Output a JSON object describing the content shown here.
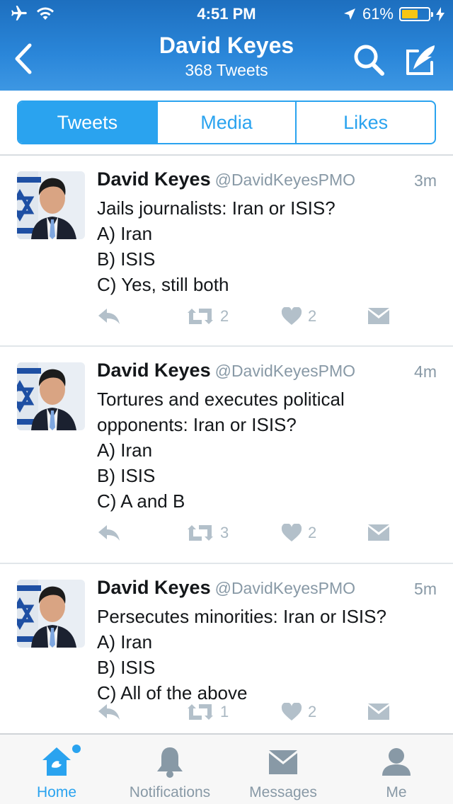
{
  "status": {
    "time": "4:51 PM",
    "battery": "61%"
  },
  "header": {
    "title": "David Keyes",
    "subtitle": "368 Tweets"
  },
  "segments": [
    {
      "label": "Tweets",
      "active": true
    },
    {
      "label": "Media",
      "active": false
    },
    {
      "label": "Likes",
      "active": false
    }
  ],
  "tweets": [
    {
      "name": "David Keyes",
      "handle": "@DavidKeyesPMO",
      "time": "3m",
      "lines": [
        "Jails journalists: Iran or ISIS?",
        "A) Iran",
        "B) ISIS",
        "C) Yes, still both"
      ],
      "retweets": "2",
      "likes": "2"
    },
    {
      "name": "David Keyes",
      "handle": "@DavidKeyesPMO",
      "time": "4m",
      "lines": [
        "Tortures and executes political",
        "opponents: Iran or ISIS?",
        "A) Iran",
        "B) ISIS",
        "C) A and B"
      ],
      "retweets": "3",
      "likes": "2"
    },
    {
      "name": "David Keyes",
      "handle": "@DavidKeyesPMO",
      "time": "5m",
      "lines": [
        "Persecutes minorities: Iran or ISIS?",
        "A) Iran",
        "B) ISIS",
        "C) All of the above"
      ],
      "retweets": "1",
      "likes": "2"
    }
  ],
  "tabbar": {
    "home": "Home",
    "notifications": "Notifications",
    "messages": "Messages",
    "me": "Me"
  },
  "colors": {
    "accent": "#2aa3ef",
    "header": "#2a86d9",
    "muted": "#8899a6"
  }
}
